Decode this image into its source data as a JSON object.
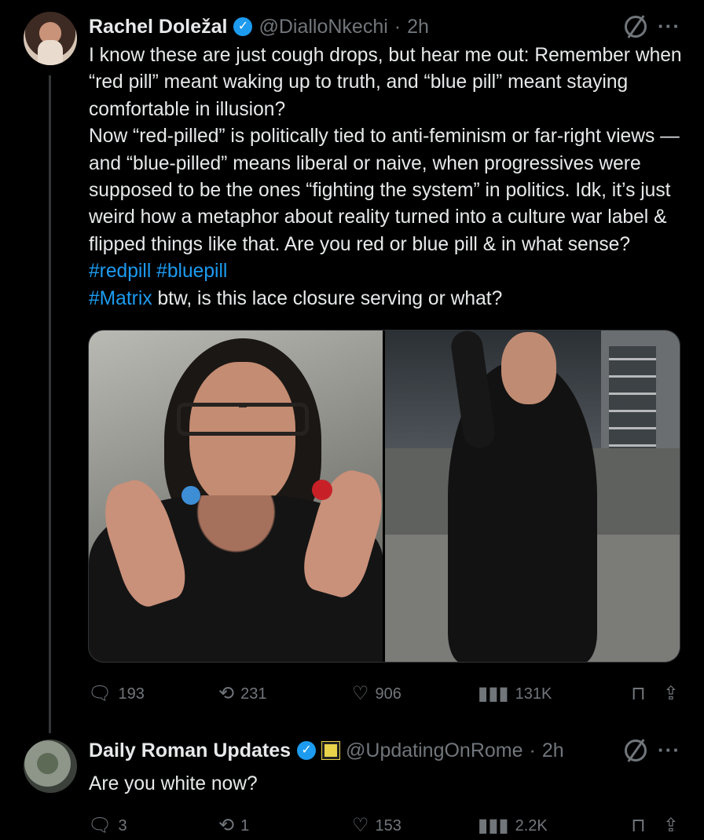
{
  "posts": [
    {
      "name": "Rachel Doležal",
      "handle": "@DialloNkechi",
      "separator": "·",
      "time": "2h",
      "text_segments": [
        {
          "text": "I know these are just cough drops, but hear me out: Remember when “red pill” meant waking up to truth, and “blue pill” meant staying comfortable in illusion?\nNow “red-pilled” is politically tied to anti-feminism or far-right views — and “blue-pilled” means liberal or naive, when progressives were supposed to be the ones “fighting the system” in politics. Idk, it’s just weird how a metaphor about reality turned into a culture war label & flipped things like that. Are you red or blue pill & in what sense? ",
          "type": "plain"
        },
        {
          "text": "#redpill",
          "type": "hashtag"
        },
        {
          "text": " ",
          "type": "plain"
        },
        {
          "text": "#bluepill",
          "type": "hashtag"
        },
        {
          "text": "\n",
          "type": "plain"
        },
        {
          "text": "#Matrix",
          "type": "hashtag"
        },
        {
          "text": " btw, is this lace closure serving or what?",
          "type": "plain"
        }
      ],
      "stats": {
        "replies": "193",
        "reposts": "231",
        "likes": "906",
        "views": "131K"
      }
    },
    {
      "name": "Daily Roman Updates",
      "handle": "@UpdatingOnRome",
      "separator": "·",
      "time": "2h",
      "text": "Are you white now?",
      "stats": {
        "replies": "3",
        "reposts": "1",
        "likes": "153",
        "views": "2.2K"
      }
    }
  ],
  "icons": {
    "verified": "verified-check-icon",
    "grok": "grok-icon",
    "more": "more-icon",
    "reply": "reply-icon",
    "repost": "repost-icon",
    "like": "like-icon",
    "views": "views-icon",
    "bookmark": "bookmark-icon",
    "share": "share-icon"
  },
  "colors": {
    "background": "#000000",
    "text": "#e7e9ea",
    "muted": "#71767b",
    "accent": "#1d9bf0",
    "verified": "#1d9bf0",
    "affiliate_badge": "#e8d34a"
  }
}
